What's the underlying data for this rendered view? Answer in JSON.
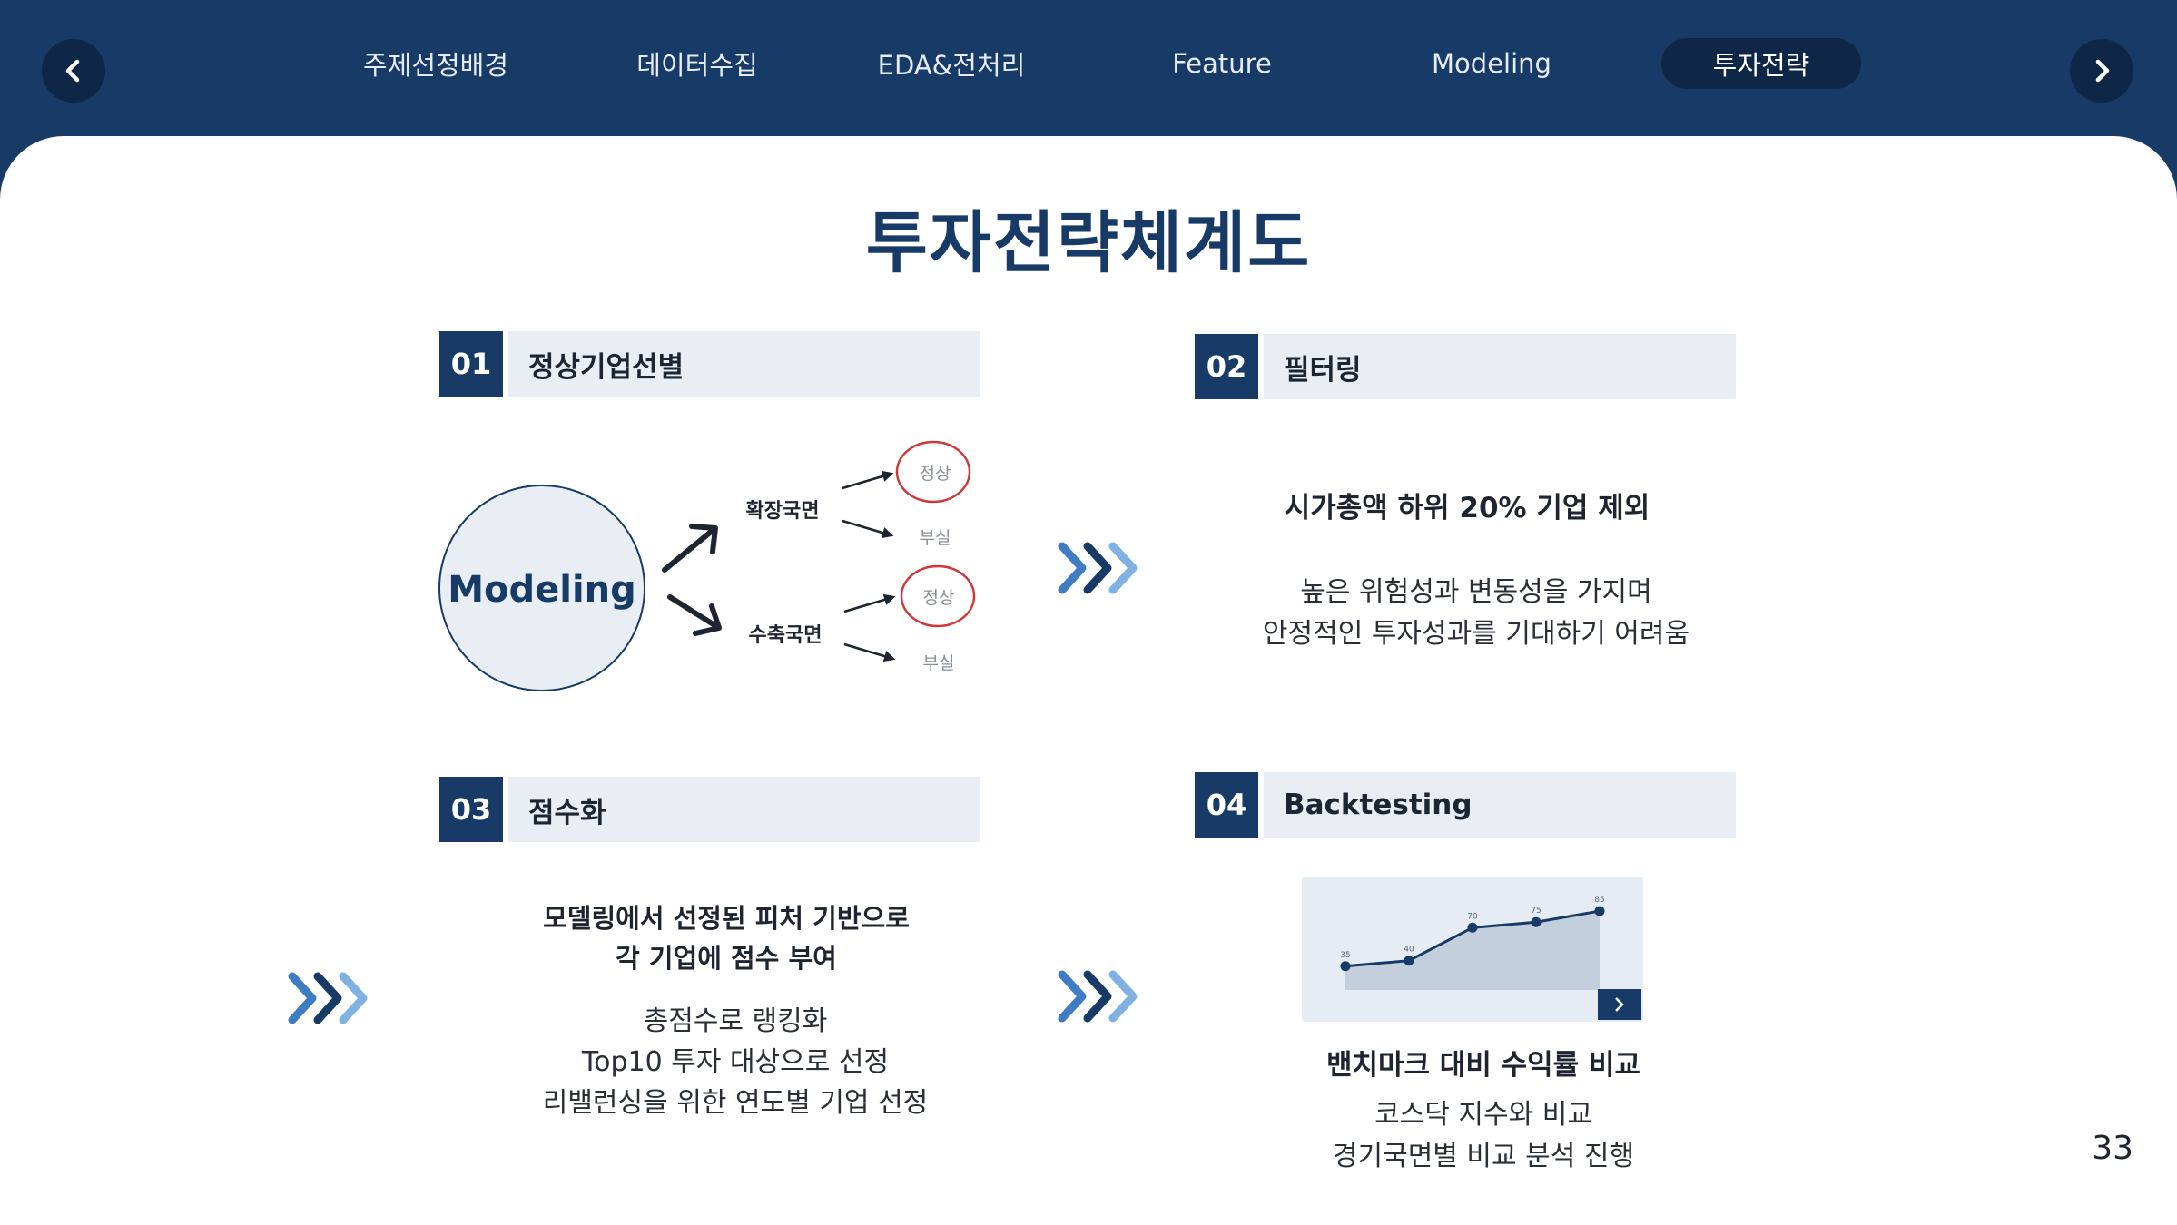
{
  "nav": {
    "tabs": [
      {
        "label": "주제선정배경"
      },
      {
        "label": "데이터수집"
      },
      {
        "label": "EDA&전처리"
      },
      {
        "label": "Feature"
      },
      {
        "label": "Modeling"
      },
      {
        "label": "투자전략"
      }
    ],
    "active_tab": "투자전략"
  },
  "slide": {
    "title": "투자전략체계도",
    "page_number": "33",
    "sections": [
      {
        "number": "01",
        "label": "정상기업선별",
        "diagram": {
          "center": "Modeling",
          "branch_up": "확장국면",
          "branch_down": "수축국면",
          "normal": "정상",
          "bankrupt": "부실"
        }
      },
      {
        "number": "02",
        "label": "필터링",
        "headline": "시가총액 하위 20% 기업 제외",
        "lines": [
          "높은 위험성과 변동성을 가지며",
          "안정적인 투자성과를 기대하기 어려움"
        ]
      },
      {
        "number": "03",
        "label": "점수화",
        "headline_lines": [
          "모델링에서 선정된 피처 기반으로",
          "각 기업에 점수 부여"
        ],
        "lines": [
          "총점수로 랭킹화",
          "Top10 투자 대상으로 선정",
          "리밸런싱을 위한 연도별 기업 선정"
        ]
      },
      {
        "number": "04",
        "label": "Backtesting",
        "headline": "밴치마크 대비 수익률 비교",
        "lines": [
          "코스닥 지수와 비교",
          "경기국면별 비교 분석 진행"
        ]
      }
    ]
  },
  "chart_data": {
    "type": "area",
    "x": [
      1,
      2,
      3,
      4,
      5
    ],
    "values": [
      35,
      40,
      70,
      75,
      85
    ],
    "data_labels": [
      "35",
      "40",
      "70",
      "75",
      "85"
    ],
    "ylim": [
      0,
      100
    ],
    "colors": {
      "fill": "#c3cfdd",
      "line": "#173a67",
      "frame": "#e6ecf4"
    }
  },
  "colors": {
    "navy": "#173a67",
    "dark_navy": "#0f2747",
    "light_panel": "#e9eef5",
    "circle_red": "#d03838",
    "chevron_light": "#7fb1e3",
    "chevron_mid": "#3f7cc4"
  },
  "icons": [
    "chevron-left-icon",
    "chevron-right-icon",
    "triple-chevron-icon",
    "arrow-up-right-icon",
    "arrow-down-right-icon"
  ]
}
